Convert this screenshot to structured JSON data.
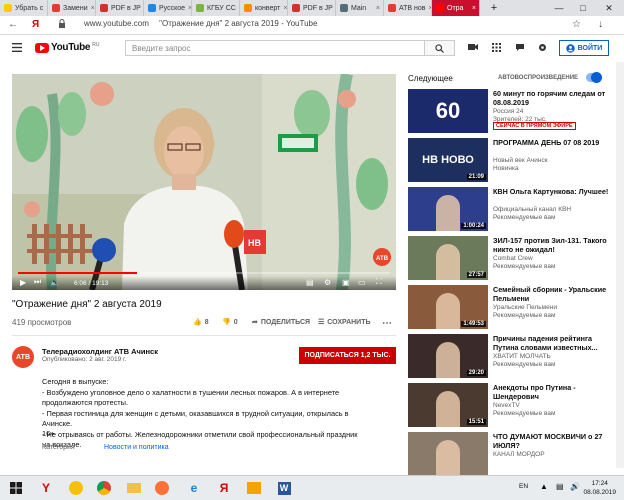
{
  "browser": {
    "tabs": [
      {
        "label": "Убрать с",
        "color": "#ffcc00"
      },
      {
        "label": "Замени",
        "color": "#e53935"
      },
      {
        "label": "PDF в JP",
        "color": "#d32f2f"
      },
      {
        "label": "Русское",
        "color": "#1e88e5"
      },
      {
        "label": "КГБУ СС",
        "color": "#7cb342"
      },
      {
        "label": "конверт",
        "color": "#fb8c00"
      },
      {
        "label": "PDF в JP",
        "color": "#d32f2f"
      },
      {
        "label": "Main",
        "color": "#546e7a"
      },
      {
        "label": "АТВ нов",
        "color": "#e53935"
      },
      {
        "label": "Отра",
        "color": "#ff0000",
        "active": true
      }
    ],
    "new_tab": "+",
    "url": "www.youtube.com",
    "page_title": "\"Отражение дня\" 2 августа 2019 - YouTube",
    "yandex_letter": "Я"
  },
  "youtube": {
    "logo_text": "YouTube",
    "logo_region": "RU",
    "search_placeholder": "Введите запрос",
    "signin_label": "ВОЙТИ"
  },
  "video": {
    "title": "\"Отражение дня\" 2 августа 2019",
    "views": "419 просмотров",
    "likes": "8",
    "dislikes": "0",
    "share_label": "ПОДЕЛИТЬСЯ",
    "save_label": "СОХРАНИТЬ",
    "time": "6:06 / 19:13",
    "progress": 0.32,
    "mic_logo": "НВ"
  },
  "channel": {
    "avatar_text": "АТВ",
    "name": "Телерадиохолдинг АТВ Ачинск",
    "published": "Опубликовано: 2 авг. 2019 г.",
    "subscribe_label": "ПОДПИСАТЬСЯ  1,2 ТЫС."
  },
  "description": {
    "lines": [
      "Сегодня в выпуске:",
      "- Возбуждено уголовное дело о халатности в тушении лесных пожаров. А в интернете",
      "продолжаются протесты.",
      "- Первая гостиница для женщин с детьми, оказавшихся в трудной ситуации, открылась в",
      "Ачинске.",
      "- Не отрываясь от работы. Железнодорожники отметили свой профессиональный праздник",
      "на вокзале."
    ],
    "age": "16+",
    "category_label": "Категория",
    "category_value": "Новости и политика"
  },
  "sidebar": {
    "next_label": "Следующее",
    "autoplay_label": "АВТОВОСПРОИЗВЕДЕНИЕ",
    "items": [
      {
        "title": "60 минут по горячим следам от 08.08.2019",
        "channel": "Россия 24",
        "meta": "Зрителей: 22 тыс.",
        "badge": "СЕЙЧАС В ПРЯМОМ ЭФИРЕ",
        "duration": "",
        "thumb_text": "60",
        "bg": "#1b2a6b"
      },
      {
        "title": "ПРОГРАММА ДЕНЬ 07 08 2019",
        "channel": "Новый век Ачинск",
        "meta": "Новинка",
        "badge": "",
        "duration": "21:09",
        "thumb_text": "НВ НОВО",
        "bg": "#1c2f5e"
      },
      {
        "title": "КВН Ольга Картункова: Лучшее!",
        "channel": "Официальный канал КВН",
        "meta": "Рекомендуемые вам",
        "badge": "",
        "duration": "1:00:24",
        "thumb_text": "",
        "bg": "#2d3f8c"
      },
      {
        "title": "ЗИЛ-157 против Зил-131. Такого никто не ожидал!",
        "channel": "Combat Crew",
        "meta": "Рекомендуемые вам",
        "badge": "",
        "duration": "27:57",
        "thumb_text": "",
        "bg": "#6b7a5a"
      },
      {
        "title": "Семейный сборник - Уральские Пельмени",
        "channel": "Уральские Пельмени",
        "meta": "Рекомендуемые вам",
        "badge": "",
        "duration": "1:49:53",
        "thumb_text": "",
        "bg": "#8a5a3c"
      },
      {
        "title": "Причины падения рейтинга Путина словами известных...",
        "channel": "ХВАТИТ МОЛЧАТЬ",
        "meta": "Рекомендуемые вам",
        "badge": "",
        "duration": "29:20",
        "thumb_text": "",
        "bg": "#3a2a2a"
      },
      {
        "title": "Анекдоты про Путина - Шендерович",
        "channel": "NevexTV",
        "meta": "Рекомендуемые вам",
        "badge": "",
        "duration": "15:51",
        "thumb_text": "",
        "bg": "#4a3a30"
      },
      {
        "title": "ЧТО ДУМАЮТ МОСКВИЧИ о 27 ИЮЛЯ?",
        "channel": "КАНАЛ МОРДОР",
        "meta": "",
        "badge": "",
        "duration": "",
        "thumb_text": "",
        "bg": "#8a7a6a"
      }
    ]
  },
  "taskbar": {
    "lang": "EN",
    "time": "17:24",
    "date": "08.08.2019"
  }
}
